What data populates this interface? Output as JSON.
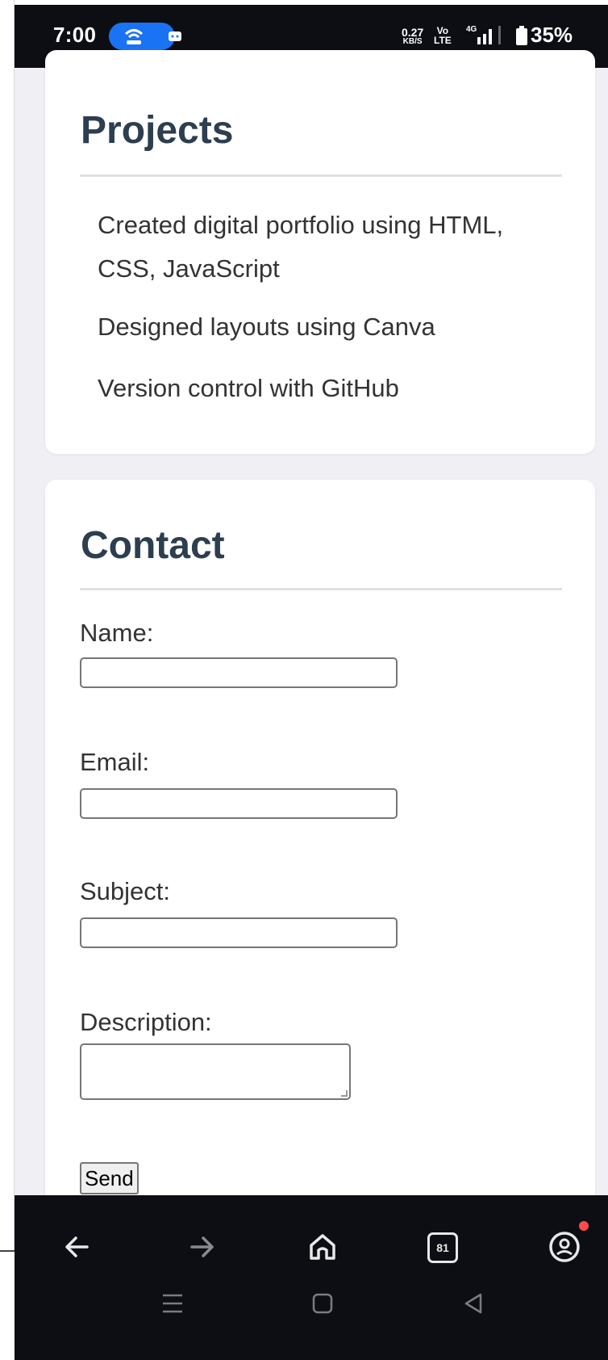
{
  "status_bar": {
    "time": "7:00",
    "net_speed": "0.27",
    "net_unit": "KB/S",
    "volte_top": "Vo",
    "volte_bottom": "LTE",
    "network": "4G",
    "battery": "35%"
  },
  "projects": {
    "title": "Projects",
    "items": [
      "Created digital portfolio using HTML,",
      "CSS, JavaScript",
      "Designed layouts using Canva",
      "Version control with GitHub"
    ]
  },
  "contact": {
    "title": "Contact",
    "name_label": "Name:",
    "email_label": "Email:",
    "subject_label": "Subject:",
    "description_label": "Description:",
    "name_value": "",
    "email_value": "",
    "subject_value": "",
    "description_value": "",
    "send_label": "Send"
  },
  "toolbar": {
    "tab_count": "81",
    "icons": [
      "back-arrow-icon",
      "forward-arrow-icon",
      "home-icon",
      "tab-switcher-icon",
      "account-icon"
    ]
  },
  "system_nav": {
    "icons": [
      "recent-apps-icon",
      "home-square-icon",
      "back-triangle-icon"
    ]
  },
  "colors": {
    "heading": "#2c3e50",
    "page_background": "#f0eff4",
    "status_bar": "#0d0e14",
    "pill": "#1a73f5",
    "notification_dot": "#ff4b4b"
  }
}
